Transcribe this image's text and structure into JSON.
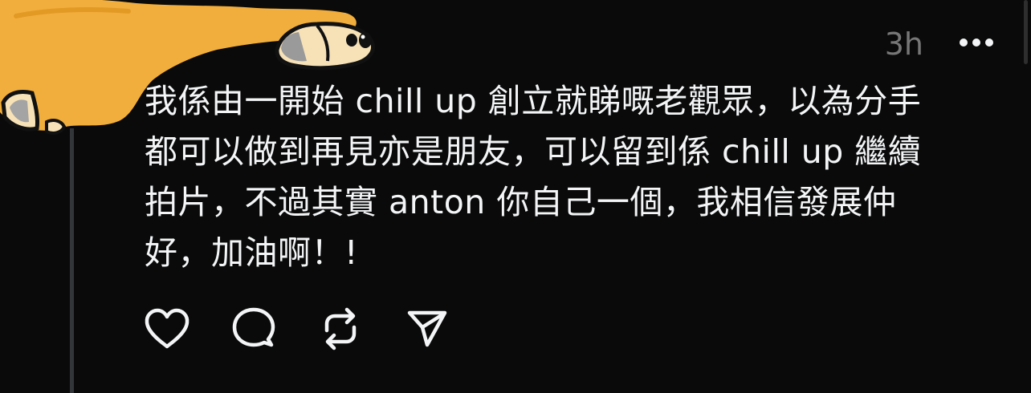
{
  "post": {
    "timestamp": "3h",
    "text": "我係由一開始 chill up 創立就睇嘅老觀眾，以為分手\n都可以做到再見亦是朋友，可以留到係 chill up 繼續\n拍片，不過其實 anton 你自己一個，我相信發展仲\n好，加油啊！!",
    "more_icon": "ellipsis-icon",
    "avatar_icon": "dog-sticker-avatar"
  },
  "actions": [
    {
      "name": "like-button",
      "icon": "heart-icon"
    },
    {
      "name": "reply-button",
      "icon": "comment-icon"
    },
    {
      "name": "repost-button",
      "icon": "repost-icon"
    },
    {
      "name": "share-button",
      "icon": "send-icon"
    }
  ],
  "colors": {
    "background": "#0a0a0a",
    "text": "#f3f5f7",
    "muted": "#777777",
    "avatar_orange": "#f2ae3c",
    "thread_line": "#333638"
  }
}
